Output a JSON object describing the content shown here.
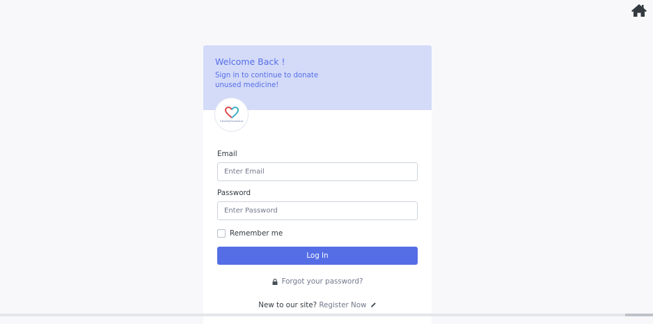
{
  "header": {
    "home_icon": "home-icon",
    "home_color": "#343a40"
  },
  "card": {
    "welcome_title": "Welcome Back !",
    "subtitle": "Sign in to continue to donate unused medicine!",
    "header_bg": "#d4dbf9",
    "accent": "#556ee6",
    "logo": {
      "icon": "heart-logo-icon",
      "text": "CharityDonation"
    }
  },
  "form": {
    "email_label": "Email",
    "email_placeholder": "Enter Email",
    "email_value": "",
    "password_label": "Password",
    "password_placeholder": "Enter Password",
    "password_value": "",
    "remember_label": "Remember me",
    "remember_checked": false,
    "login_label": "Log In",
    "forgot_label": "Forgot your password?",
    "forgot_icon": "lock-icon",
    "register_prompt": "New to our site?",
    "register_link": "Register Now",
    "register_icon": "pencil-icon"
  }
}
